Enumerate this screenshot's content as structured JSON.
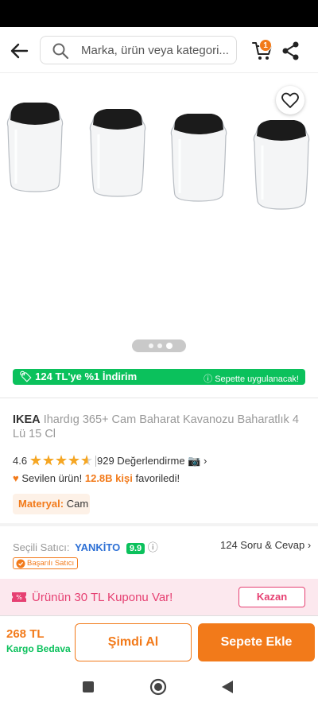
{
  "search": {
    "placeholder": "Marka, ürün veya kategori..."
  },
  "cart": {
    "badge_count": "1"
  },
  "gallery": {
    "image_alt": "Ihardıg 365+ cam baharat kavanozları",
    "active_dot": 3,
    "dot_count": 3
  },
  "promo": {
    "left_text": "124 TL'ye %1 İndirim",
    "right_text": "Sepette uygulanacak!"
  },
  "product": {
    "brand": "IKEA",
    "name": "Ihardıg 365+ Cam Baharat Kavanozu Baharatlık 4 Lü 15 Cl",
    "rating": "4.6",
    "rating_value": 4.6,
    "review_count": "929 Değerlendirme",
    "favorite_prefix": "Sevilen ürün!",
    "favorite_count": "12.8B kişi",
    "favorite_suffix": "favoriledi!",
    "attr_key": "Materyal:",
    "attr_value": "Cam"
  },
  "seller": {
    "label": "Seçili Satıcı:",
    "name": "YANKİTO",
    "score": "9.9",
    "qa": "124 Soru & Cevap",
    "badge": "Başarılı Satıcı"
  },
  "coupon": {
    "text": "Ürünün 30 TL Kuponu Var!",
    "button": "Kazan"
  },
  "bottom": {
    "price": "268 TL",
    "shipping": "Kargo Bedava",
    "buy_now": "Şimdi Al",
    "add_to_cart": "Sepete Ekle"
  },
  "colors": {
    "accent": "#f27a1a",
    "green": "#0bc15c",
    "link": "#2d70d5",
    "coupon": "#e64072"
  }
}
